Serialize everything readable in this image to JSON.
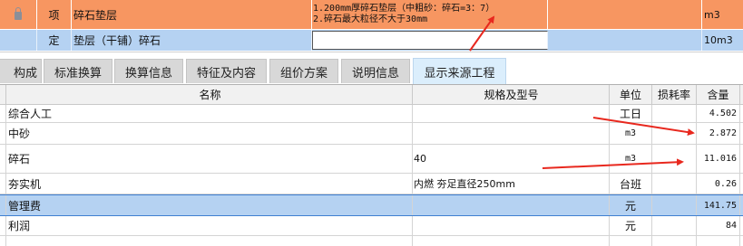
{
  "item_rows": [
    {
      "kind": "项",
      "name": "碎石垫层",
      "desc_lines": [
        "1.200mm厚碎石垫层（中粗砂：碎石=3：7）",
        "2.碎石最大粒径不大于30mm"
      ],
      "unit": "m3"
    },
    {
      "kind": "定",
      "name": "垫层（干铺）碎石",
      "desc_lines": [],
      "unit": "10m3"
    }
  ],
  "tabs": [
    "构成",
    "标准换算",
    "换算信息",
    "特征及内容",
    "组价方案",
    "说明信息",
    "显示来源工程"
  ],
  "active_tab": "显示来源工程",
  "grid": {
    "headers": {
      "name": "名称",
      "spec": "规格及型号",
      "unit": "单位",
      "loss_rate": "损耗率",
      "content": "含量"
    },
    "rows": [
      {
        "name": "综合人工",
        "spec": "",
        "unit": "工日",
        "loss_rate": "",
        "content": "4.502",
        "selected": false
      },
      {
        "name": "中砂",
        "spec": "",
        "unit": "m3",
        "loss_rate": "",
        "content": "2.872",
        "selected": false
      },
      {
        "name": "碎石",
        "spec": "40",
        "unit": "m3",
        "loss_rate": "",
        "content": "11.016",
        "selected": false
      },
      {
        "name": "夯实机",
        "spec": "内燃 夯足直径250mm",
        "unit": "台班",
        "loss_rate": "",
        "content": "0.26",
        "selected": false
      },
      {
        "name": "管理费",
        "spec": "",
        "unit": "元",
        "loss_rate": "",
        "content": "141.75",
        "selected": true
      },
      {
        "name": "利润",
        "spec": "",
        "unit": "元",
        "loss_rate": "",
        "content": "84",
        "selected": false
      }
    ]
  },
  "colors": {
    "item_row_highlight": "#f79661",
    "selected_row": "#b5d2f2",
    "active_tab": "#dbeefc",
    "annotation_arrow": "#e8281e"
  }
}
